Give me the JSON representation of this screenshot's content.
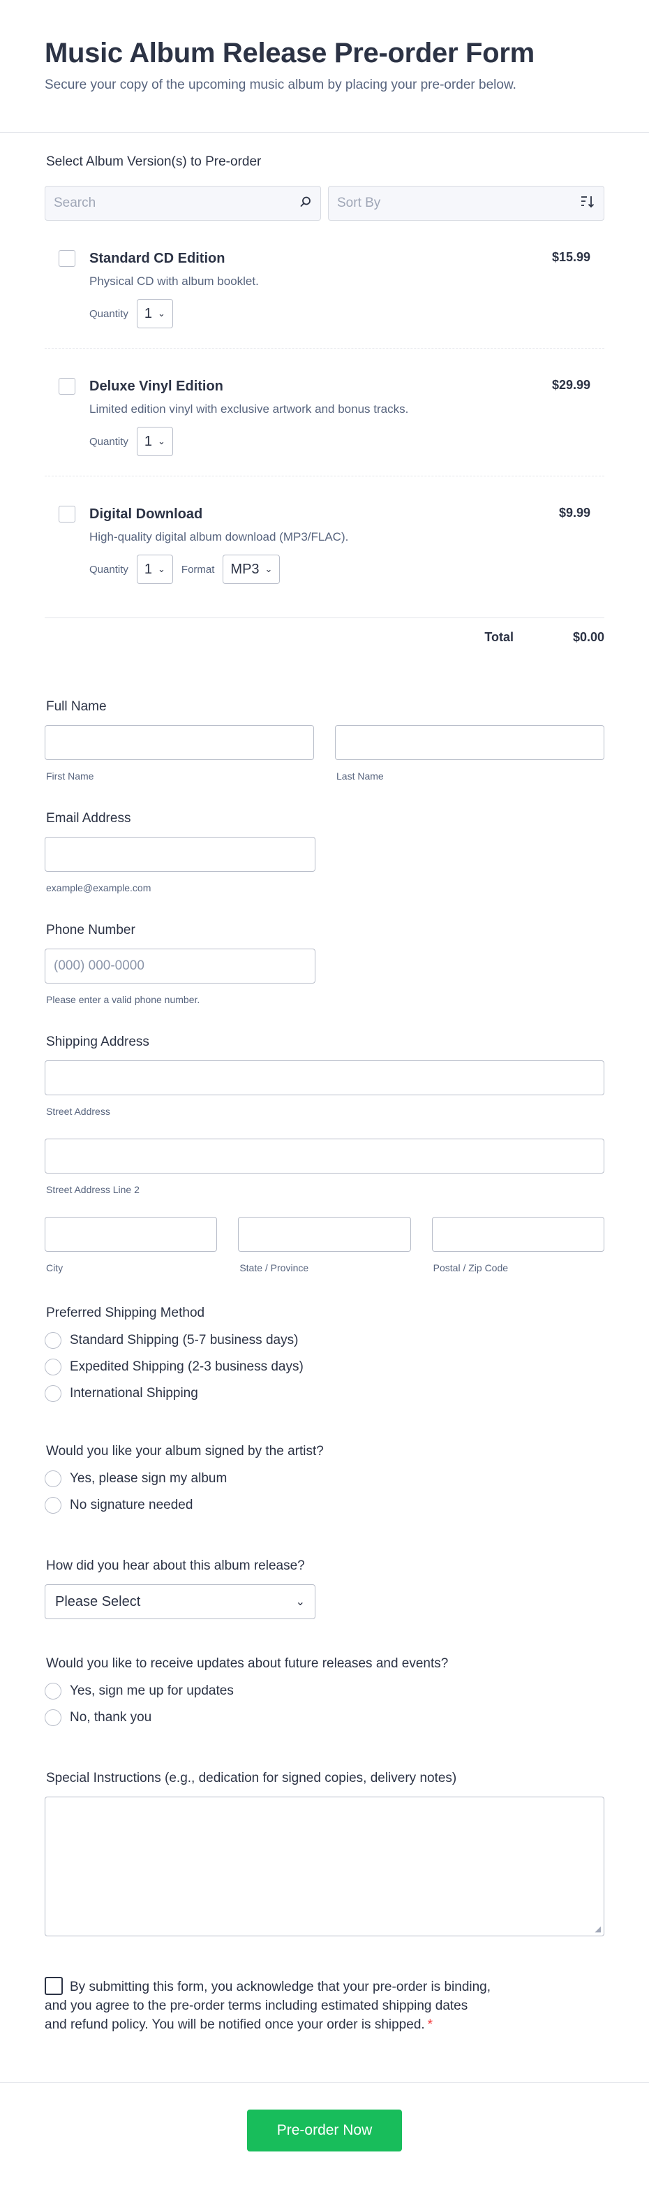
{
  "header": {
    "title": "Music Album Release Pre-order Form",
    "subtitle": "Secure your copy of the upcoming music album by placing your pre-order below."
  },
  "products_section": {
    "label": "Select Album Version(s) to Pre-order",
    "search_placeholder": "Search",
    "sort_placeholder": "Sort By",
    "items": [
      {
        "name": "Standard CD Edition",
        "price": "$15.99",
        "description": "Physical CD with album booklet.",
        "quantity_label": "Quantity",
        "quantity": "1"
      },
      {
        "name": "Deluxe Vinyl Edition",
        "price": "$29.99",
        "description": "Limited edition vinyl with exclusive artwork and bonus tracks.",
        "quantity_label": "Quantity",
        "quantity": "1"
      },
      {
        "name": "Digital Download",
        "price": "$9.99",
        "description": "High-quality digital album download (MP3/FLAC).",
        "quantity_label": "Quantity",
        "quantity": "1",
        "format_label": "Format",
        "format": "MP3"
      }
    ],
    "total_label": "Total",
    "total_value": "$0.00"
  },
  "full_name": {
    "label": "Full Name",
    "first_sublabel": "First Name",
    "last_sublabel": "Last Name"
  },
  "email": {
    "label": "Email Address",
    "sublabel": "example@example.com"
  },
  "phone": {
    "label": "Phone Number",
    "placeholder": "(000) 000-0000",
    "sublabel": "Please enter a valid phone number."
  },
  "address": {
    "label": "Shipping Address",
    "street_sublabel": "Street Address",
    "street2_sublabel": "Street Address Line 2",
    "city_sublabel": "City",
    "state_sublabel": "State / Province",
    "zip_sublabel": "Postal / Zip Code"
  },
  "shipping_method": {
    "label": "Preferred Shipping Method",
    "options": [
      "Standard Shipping (5-7 business days)",
      "Expedited Shipping (2-3 business days)",
      "International Shipping"
    ]
  },
  "signed": {
    "label": "Would you like your album signed by the artist?",
    "options": [
      "Yes, please sign my album",
      "No signature needed"
    ]
  },
  "heard": {
    "label": "How did you hear about this album release?",
    "selected": "Please Select"
  },
  "updates": {
    "label": "Would you like to receive updates about future releases and events?",
    "options": [
      "Yes, sign me up for updates",
      "No, thank you"
    ]
  },
  "instructions": {
    "label": "Special Instructions (e.g., dedication for signed copies, delivery notes)"
  },
  "consent": {
    "line1": "By submitting this form, you acknowledge that your pre-order is binding,",
    "line2": "and you agree to the pre-order terms including estimated shipping dates",
    "line3": "and refund policy. You will be notified once your order is shipped.",
    "required_mark": "*"
  },
  "submit_label": "Pre-order Now",
  "colors": {
    "accent": "#18bd5b",
    "required": "#f23a3c",
    "text": "#2c3345"
  }
}
